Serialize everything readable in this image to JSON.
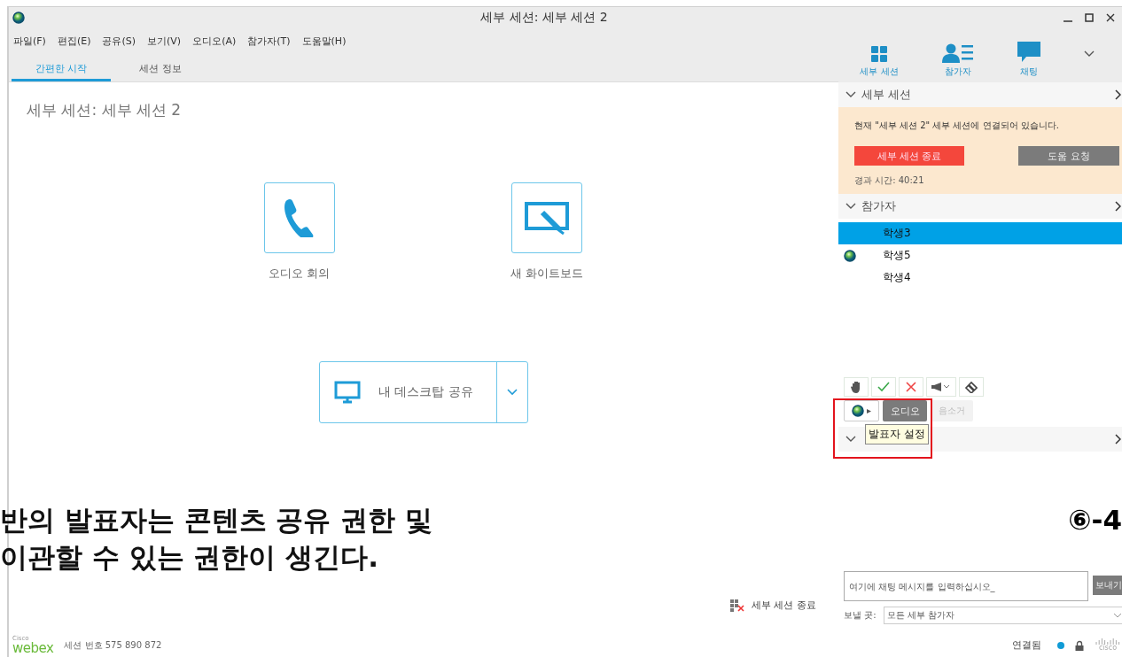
{
  "window": {
    "title": "세부 세션: 세부 세션 2"
  },
  "menu": [
    "파일(F)",
    "편집(E)",
    "공유(S)",
    "보기(V)",
    "오디오(A)",
    "참가자(T)",
    "도움말(H)"
  ],
  "tabs": [
    {
      "label": "간편한 시작",
      "selected": true
    },
    {
      "label": "세션 정보",
      "selected": false
    }
  ],
  "main": {
    "heading": "세부 세션: 세부 세션 2",
    "actions": [
      {
        "label": "오디오 회의",
        "kind": "phone"
      },
      {
        "label": "새 화이트보드",
        "kind": "whiteboard"
      }
    ],
    "share": {
      "label": "내 데스크탑 공유"
    },
    "end_session": "세부 세션 종료"
  },
  "panel_tabs": [
    {
      "label": "세부 세션",
      "kind": "grid"
    },
    {
      "label": "참가자",
      "kind": "people"
    },
    {
      "label": "채팅",
      "kind": "chat"
    }
  ],
  "breakout": {
    "title": "세부 세션",
    "message": "현재 \"세부 세션 2\" 세부 세션에 연결되어 있습니다.",
    "end_button": "세부 세션 종료",
    "help_button": "도움 요청",
    "elapsed": "경과 시간: 40:21"
  },
  "participants": {
    "title": "참가자",
    "items": [
      {
        "name": "학생3",
        "selected": true,
        "presenter": false
      },
      {
        "name": "학생5",
        "selected": false,
        "presenter": true
      },
      {
        "name": "학생4",
        "selected": false,
        "presenter": false
      }
    ]
  },
  "controls": {
    "audio_button": "오디오",
    "mute_button": "음소거",
    "mute_disabled": true,
    "tooltip": "발표자 설정"
  },
  "chat": {
    "placeholder": "여기에 채팅 메시지를 입력하십시오_",
    "send": "보내기",
    "to_label": "보낼 곳:",
    "to_value": "모든 세부 참가자"
  },
  "status_bar": {
    "brand_small": "Cisco",
    "brand": "webex",
    "session_number": "세션 번호 575 890 872",
    "connection": "연결됨",
    "vendor": "cisco"
  },
  "caption": {
    "lines": [
      "반의 발표자는 콘텐츠 공유 권한 및",
      "이관할 수 있는 권한이 생긴다."
    ],
    "number": "⑥-4"
  }
}
